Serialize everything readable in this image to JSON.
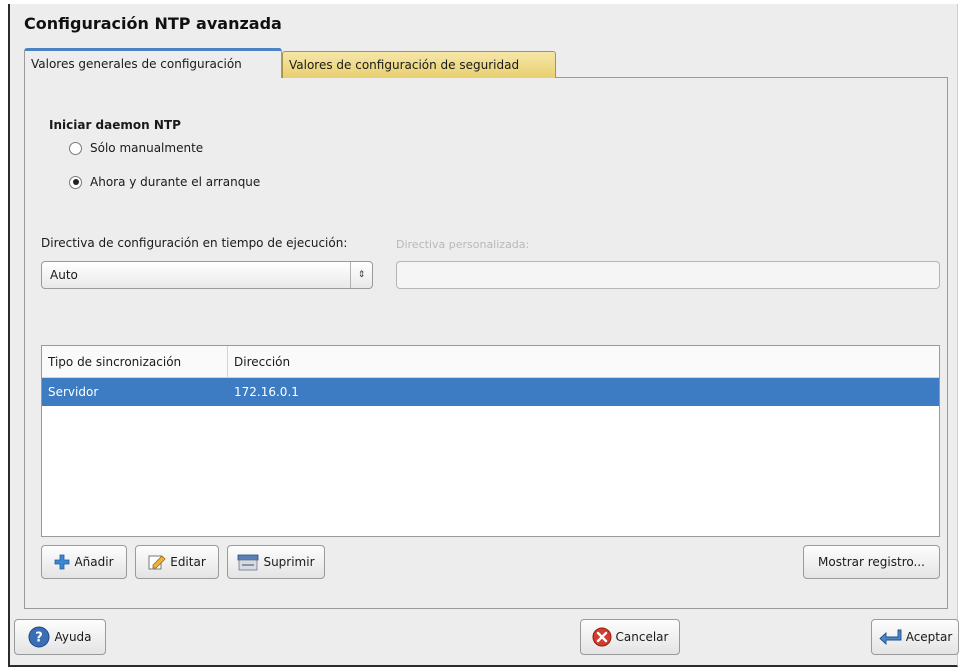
{
  "dialog": {
    "title": "Configuración NTP avanzada"
  },
  "tabs": [
    {
      "label": "Valores generales de configuración",
      "active": true
    },
    {
      "label": "Valores de configuración de seguridad",
      "active": false
    }
  ],
  "daemon": {
    "heading": "Iniciar daemon NTP",
    "options": [
      {
        "label": "Sólo manualmente",
        "selected": false
      },
      {
        "label": "Ahora y durante el arranque",
        "selected": true
      }
    ]
  },
  "policy": {
    "label": "Directiva de configuración en tiempo de ejecución:",
    "value": "Auto",
    "custom_label": "Directiva personalizada:",
    "custom_value": ""
  },
  "sync_table": {
    "columns": [
      "Tipo de sincronización",
      "Dirección"
    ],
    "rows": [
      {
        "type": "Servidor",
        "address": "172.16.0.1",
        "selected": true
      }
    ]
  },
  "table_buttons": {
    "add": "Añadir",
    "edit": "Editar",
    "delete": "Suprimir",
    "show_log": "Mostrar registro..."
  },
  "footer": {
    "help": "Ayuda",
    "cancel": "Cancelar",
    "accept": "Aceptar"
  },
  "colors": {
    "accent": "#3d7cc2",
    "inactive_tab": "#efd98a",
    "cancel_icon": "#d33b2c",
    "help_icon": "#3b6fb5"
  }
}
